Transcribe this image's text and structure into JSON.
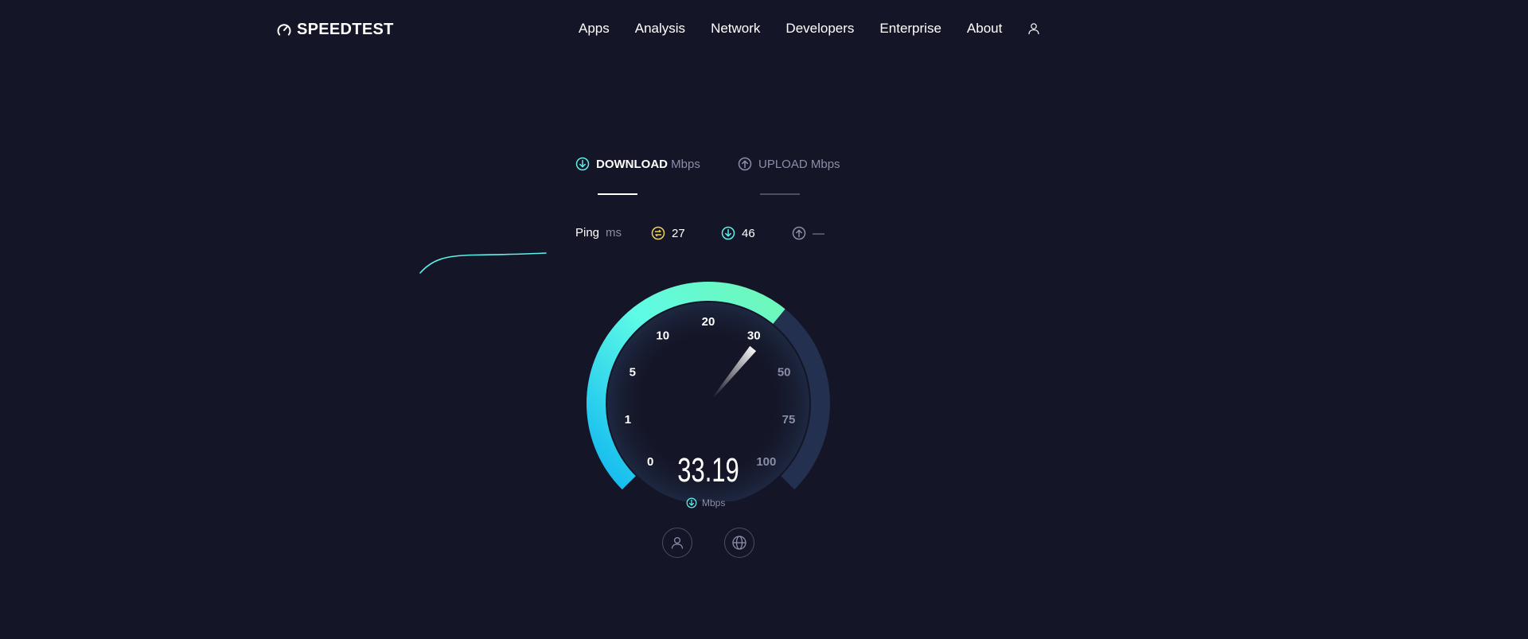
{
  "header": {
    "logo_text": "SPEEDTEST",
    "nav": [
      "Apps",
      "Analysis",
      "Network",
      "Developers",
      "Enterprise",
      "About"
    ]
  },
  "tabs": {
    "download": {
      "label": "DOWNLOAD",
      "unit": "Mbps"
    },
    "upload": {
      "label": "UPLOAD",
      "unit": "Mbps"
    }
  },
  "ping": {
    "label": "Ping",
    "unit": "ms",
    "jitter": "27",
    "download": "46",
    "upload": "—"
  },
  "gauge": {
    "ticks": [
      "0",
      "1",
      "5",
      "10",
      "20",
      "30",
      "50",
      "75",
      "100"
    ],
    "current_value": "33.19",
    "unit": "Mbps"
  },
  "colors": {
    "background": "#141526",
    "gauge_start": "#0fb6f0",
    "gauge_mid": "#5efbe6",
    "gauge_end": "#6ff7b6",
    "gauge_track": "#24304f",
    "accent_cyan": "#5ef0e8",
    "jitter_yellow": "#f2d15a"
  }
}
